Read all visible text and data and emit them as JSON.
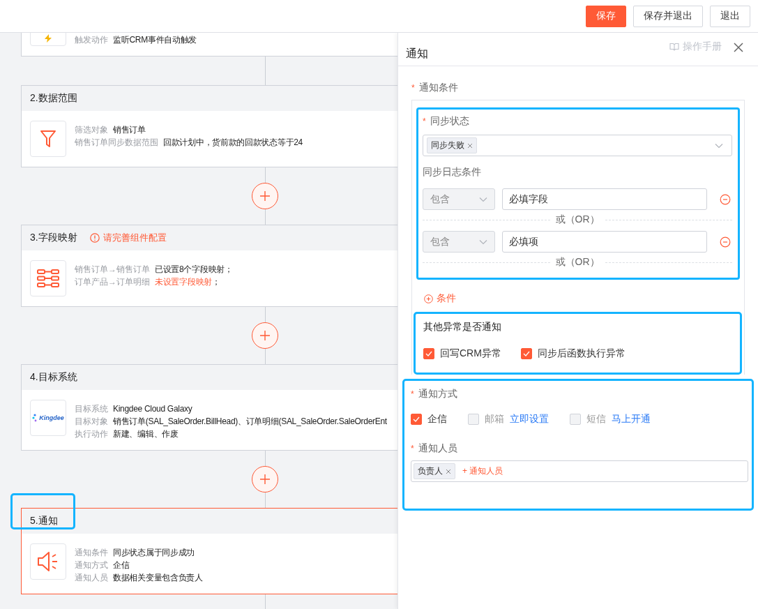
{
  "toolbar": {
    "buttons": [
      {
        "label": "保存",
        "kind": "primary"
      },
      {
        "label": "保存并退出",
        "kind": "default"
      },
      {
        "label": "退出",
        "kind": "default"
      }
    ]
  },
  "flow": {
    "steps": [
      {
        "kind": "trigger",
        "selected": false,
        "rows": [
          {
            "label": "触发动作",
            "value": "监听CRM事件自动触发"
          }
        ]
      },
      {
        "title": "2.数据范围",
        "kind": "filter",
        "selected": false,
        "rows": [
          {
            "label": "筛选对象",
            "value": "销售订单"
          },
          {
            "label": "销售订单同步数据范围",
            "value": "回款计划中，货前款的回款状态等于24"
          }
        ]
      },
      {
        "title": "3.字段映射",
        "warning": "请完善组件配置",
        "kind": "mapping",
        "selected": false,
        "rows": [
          {
            "label": "销售订单→销售订单",
            "value": "已设置8个字段映射；"
          },
          {
            "label": "订单产品→订单明细",
            "value": "未设置字段映射",
            "error": true,
            "suffix": "；"
          }
        ]
      },
      {
        "title": "4.目标系统",
        "kind": "logo",
        "logo_text": "Kingdee",
        "selected": false,
        "rows": [
          {
            "label": "目标系统",
            "value": "Kingdee Cloud Galaxy"
          },
          {
            "label": "目标对象",
            "value": "销售订单(SAL_SaleOrder.BillHead)、订单明细(SAL_SaleOrder.SaleOrderEnt"
          },
          {
            "label": "执行动作",
            "value": "新建、编辑、作废"
          }
        ]
      },
      {
        "title": "5.通知",
        "title_highlighted": true,
        "kind": "speaker",
        "selected": true,
        "rows": [
          {
            "label": "通知条件",
            "value": "同步状态属于同步成功"
          },
          {
            "label": "通知方式",
            "value": "企信"
          },
          {
            "label": "通知人员",
            "value": "数据相关变量包含负责人"
          }
        ]
      }
    ]
  },
  "panel": {
    "title": "通知",
    "manual_link": "操作手册",
    "conditions": {
      "label": "通知条件",
      "required_mark": "*",
      "highlighted": true,
      "sync_status": {
        "label": "同步状态",
        "required_mark": "*",
        "tags": [
          "同步失败"
        ]
      },
      "log_label": "同步日志条件",
      "log_conditions": [
        {
          "operator": "包含",
          "value": "必填字段",
          "separator": "或（OR）"
        },
        {
          "operator": "包含",
          "value": "必填项",
          "separator": "或（OR）"
        }
      ],
      "add_condition": "条件"
    },
    "other": {
      "title": "其他异常是否通知",
      "highlighted": true,
      "options": [
        {
          "label": "回写CRM异常",
          "checked": true
        },
        {
          "label": "同步后函数执行异常",
          "checked": true
        }
      ]
    },
    "method": {
      "label": "通知方式",
      "required_mark": "*",
      "highlighted": true,
      "options": [
        {
          "label": "企信",
          "checked": true,
          "disabled": false
        },
        {
          "label": "邮箱",
          "checked": false,
          "disabled": true,
          "link": "立即设置"
        },
        {
          "label": "短信",
          "checked": false,
          "disabled": true,
          "link": "马上开通"
        }
      ]
    },
    "recipients": {
      "label": "通知人员",
      "required_mark": "*",
      "tags": [
        "负责人"
      ],
      "add_label": "+ 通知人员"
    }
  }
}
